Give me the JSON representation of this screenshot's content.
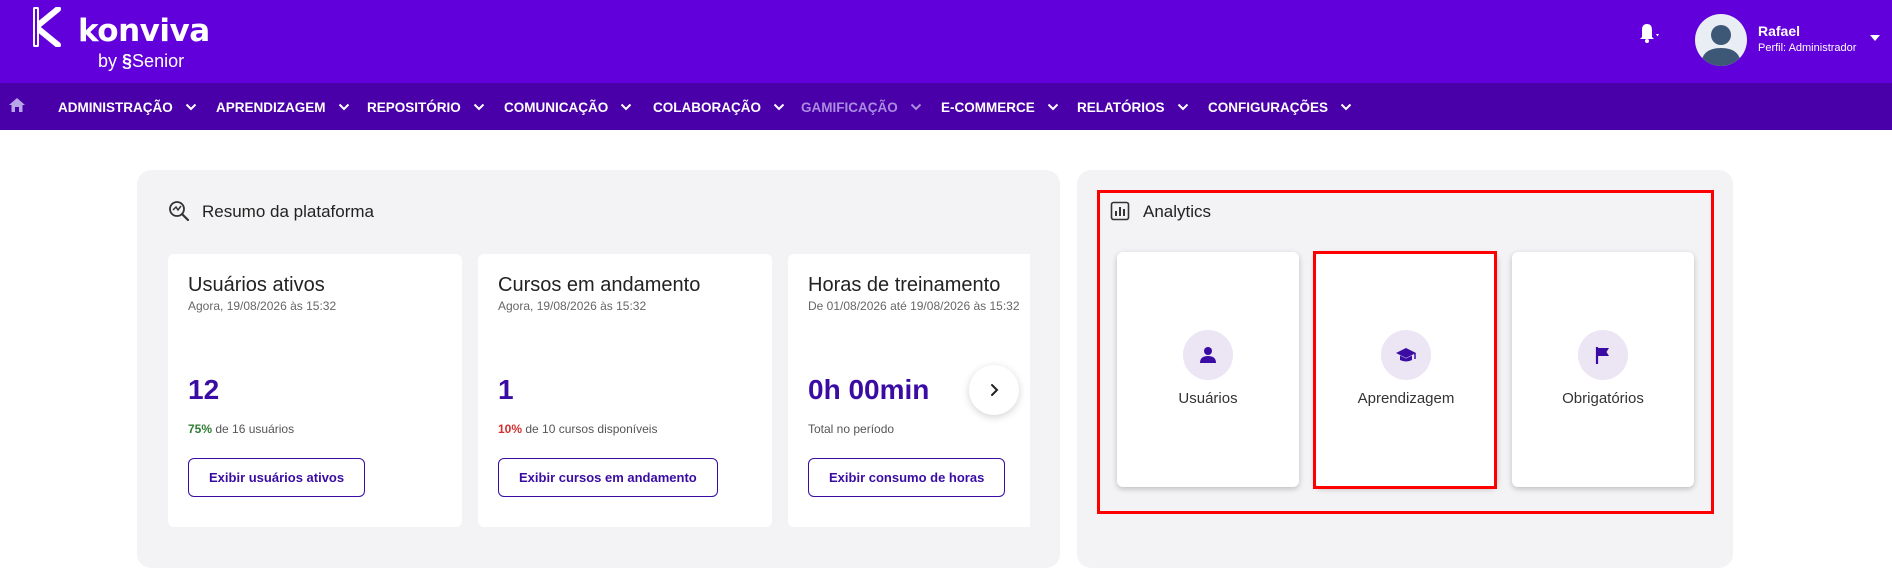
{
  "brand": {
    "name": "konviva",
    "by_label": "by",
    "company": "Senior",
    "colors": {
      "header": "#6200dc",
      "nav": "#4a00a8",
      "accent": "#3a0ca3",
      "highlight": "#ff0000"
    }
  },
  "user": {
    "name": "Rafael",
    "role": "Perfil: Administrador"
  },
  "icons": {
    "home": "home-icon",
    "bell": "bell-icon",
    "summary": "search-chart-icon",
    "analytics": "bar-chart-icon",
    "next": "chevron-right-icon"
  },
  "nav": [
    {
      "label": "ADMINISTRAÇÃO",
      "disabled": false
    },
    {
      "label": "APRENDIZAGEM",
      "disabled": false
    },
    {
      "label": "REPOSITÓRIO",
      "disabled": false
    },
    {
      "label": "COMUNICAÇÃO",
      "disabled": false
    },
    {
      "label": "COLABORAÇÃO",
      "disabled": false
    },
    {
      "label": "GAMIFICAÇÃO",
      "disabled": true
    },
    {
      "label": "E-COMMERCE",
      "disabled": false
    },
    {
      "label": "RELATÓRIOS",
      "disabled": false
    },
    {
      "label": "CONFIGURAÇÕES",
      "disabled": false
    }
  ],
  "summary": {
    "title": "Resumo da plataforma",
    "cards": [
      {
        "title": "Usuários ativos",
        "subtitle": "Agora, 19/08/2026 às 15:32",
        "value": "12",
        "pct": "75%",
        "note": " de 16 usuários",
        "button": "Exibir usuários ativos"
      },
      {
        "title": "Cursos em andamento",
        "subtitle": "Agora, 19/08/2026 às 15:32",
        "value": "1",
        "pct": "10%",
        "note": " de 10 cursos disponíveis",
        "button": "Exibir cursos em andamento"
      },
      {
        "title": "Horas de treinamento",
        "subtitle": "De 01/08/2026 até 19/08/2026 às 15:32",
        "value": "0h 00min",
        "note": "Total no período",
        "button": "Exibir consumo de horas"
      }
    ]
  },
  "analytics": {
    "title": "Analytics",
    "cards": [
      {
        "label": "Usuários",
        "icon": "user-icon"
      },
      {
        "label": "Aprendizagem",
        "icon": "graduation-cap-icon"
      },
      {
        "label": "Obrigatórios",
        "icon": "flag-icon"
      }
    ]
  }
}
